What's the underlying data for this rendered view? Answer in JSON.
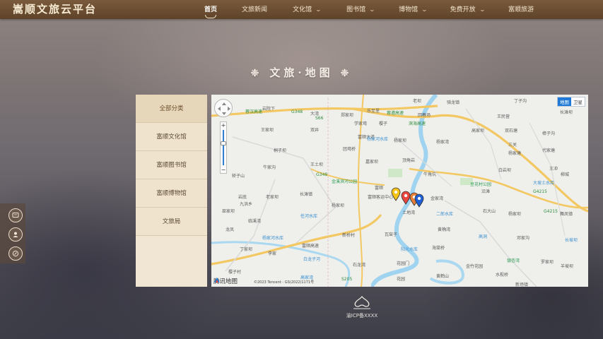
{
  "site": {
    "logo": "嵩顺文旅云平台"
  },
  "nav": [
    {
      "label": "首页",
      "active": true,
      "dropdown": false
    },
    {
      "label": "文旅新闻",
      "active": false,
      "dropdown": false
    },
    {
      "label": "文化馆",
      "active": false,
      "dropdown": true
    },
    {
      "label": "图书馆",
      "active": false,
      "dropdown": true
    },
    {
      "label": "博物馆",
      "active": false,
      "dropdown": true
    },
    {
      "label": "免费开放",
      "active": false,
      "dropdown": true
    },
    {
      "label": "富顺旅游",
      "active": false,
      "dropdown": false
    }
  ],
  "page": {
    "title": "文旅·地图"
  },
  "categories": [
    {
      "label": "全部分类",
      "active": true
    },
    {
      "label": "富顺文化馆",
      "active": false
    },
    {
      "label": "富顺图书馆",
      "active": false
    },
    {
      "label": "富顺博物馆",
      "active": false
    },
    {
      "label": "文旅局",
      "active": false
    }
  ],
  "map": {
    "type_toggle": {
      "map": "地图",
      "satellite": "卫星"
    },
    "zoom": {
      "plus": "+",
      "minus": "−"
    },
    "provider": "腾讯地图",
    "copyright": "©2023 Tencent - GS(2022)1171号",
    "labels": {
      "l1": "蓝家坝",
      "l2": "岩院下",
      "l3": "大湾",
      "l4": "郑家坝",
      "l5": "乐至里",
      "l6": "樱子",
      "l7": "学家塆",
      "l8": "老坝",
      "l9": "王家坝",
      "l10": "回春场",
      "l11": "双井",
      "l12": "樟子沟",
      "l13": "骑龙镇",
      "l14": "王民营",
      "l15": "桐子坝",
      "l16": "丁子沟",
      "l17": "长滩坝",
      "l18": "高家坝",
      "l19": "杨家坝",
      "l20": "富顺大道",
      "l21": "牛家沟",
      "l22": "杨家湾",
      "l23": "双石塘",
      "l24": "三关",
      "l25": "代家塘",
      "l26": "王土坝",
      "l27": "团塆桥",
      "l28": "嘉家坝",
      "l29": "顶角岩",
      "l30": "白岩坝",
      "l31": "杨家塘",
      "l32": "王冲",
      "l33": "轿子山",
      "l34": "富顺",
      "l35": "金溪滨河公园",
      "l36": "牛角坑",
      "l37": "豆花村公园",
      "l38": "沿滩",
      "l39": "富顺客运中心",
      "l40": "长滩镇",
      "l41": "金家湾",
      "l42": "岩底",
      "l43": "老家坝",
      "l44": "九洪乡",
      "l45": "杨家坝",
      "l46": "舞凤镇",
      "l47": "任河水库",
      "l48": "土地湾",
      "l49": "二郎水库",
      "l50": "石大山",
      "l51": "杨家坝",
      "l52": "大坡土水库",
      "l53": "临溪湾",
      "l54": "龙凤",
      "l55": "柳城",
      "l56": "邓家沟",
      "l57": "兴隆镇",
      "l58": "巫家坝",
      "l59": "黄桷湾",
      "l60": "高洞",
      "l61": "瓦窑子",
      "l62": "杨家河水库",
      "l63": "新桥村",
      "l64": "李家",
      "l65": "丁家坝",
      "l66": "石龙湾",
      "l67": "花园门",
      "l68": "阳光水库",
      "l69": "海棠桥",
      "l70": "金竹花园",
      "l71": "银杏湾",
      "l72": "罗家坝",
      "l73": "水枧桥",
      "l74": "樱子村",
      "l75": "石湾",
      "l76": "花园",
      "l77": "黄鹤山",
      "l78": "新场镇",
      "l79": "新楼沟",
      "l80": "桔子湾",
      "l81": "白龙子河",
      "l82": "高家湾",
      "l83": "马家坝",
      "l84": "杜坝",
      "l85": "琵琶沟",
      "l86": "长坡坝",
      "l87": "羊坡坝",
      "l88": "G348",
      "l89": "S66",
      "l90": "G348",
      "l91": "G4215",
      "l92": "G4215",
      "l93": "G4215",
      "l94": "S205",
      "l95": "蓉汉高速",
      "l96": "蓉遵高速",
      "l97": "滨海高速",
      "l98": "富顺高速",
      "l99": "成渝高速"
    },
    "pin_colors": [
      "#f3c316",
      "#e8453c",
      "#e8803c",
      "#1f5fd6"
    ]
  },
  "footer": {
    "text": "渝ICP备XXXX"
  },
  "colors": {
    "nav_bg": "#6b4e33",
    "panel_bg": "#efe3cd",
    "accent": "#1e7ad6"
  }
}
